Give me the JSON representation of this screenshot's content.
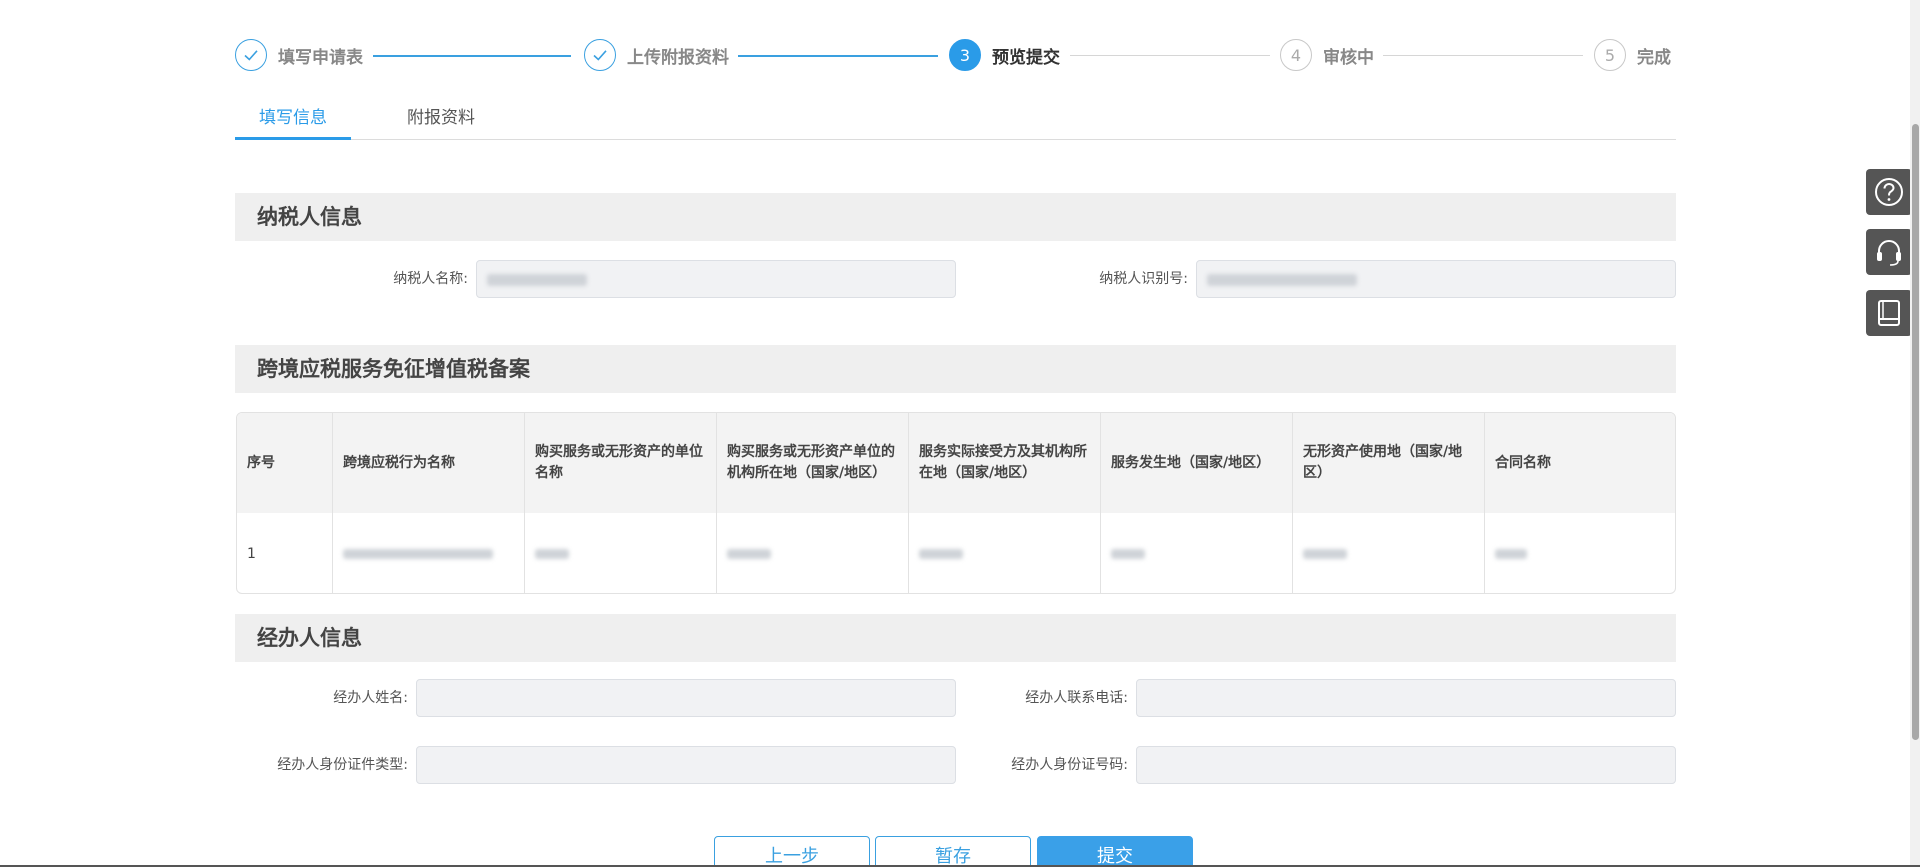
{
  "steps": [
    {
      "index": "1",
      "label": "填写申请表",
      "state": "done"
    },
    {
      "index": "2",
      "label": "上传附报资料",
      "state": "done"
    },
    {
      "index": "3",
      "label": "预览提交",
      "state": "active"
    },
    {
      "index": "4",
      "label": "审核中",
      "state": "todo"
    },
    {
      "index": "5",
      "label": "完成",
      "state": "todo"
    }
  ],
  "tabs": [
    {
      "label": "填写信息",
      "active": true
    },
    {
      "label": "附报资料",
      "active": false
    }
  ],
  "taxpayer": {
    "title": "纳税人信息",
    "name_label": "纳税人名称:",
    "id_label": "纳税人识别号:"
  },
  "filing": {
    "title": "跨境应税服务免征增值税备案",
    "columns": [
      "序号",
      "跨境应税行为名称",
      "购买服务或无形资产的单位名称",
      "购买服务或无形资产单位的机构所在地（国家/地区）",
      "服务实际接受方及其机构所在地（国家/地区）",
      "服务发生地（国家/地区）",
      "无形资产使用地（国家/地区）",
      "合同名称"
    ],
    "rows": [
      {
        "index": "1"
      }
    ]
  },
  "agent": {
    "title": "经办人信息",
    "name_label": "经办人姓名:",
    "phone_label": "经办人联系电话:",
    "id_type_label": "经办人身份证件类型:",
    "id_number_label": "经办人身份证号码:"
  },
  "buttons": {
    "prev": "上一步",
    "save": "暂存",
    "submit": "提交"
  },
  "tools": {
    "icons": [
      "help-icon",
      "headset-icon",
      "book-icon"
    ]
  },
  "colors": {
    "accent": "#2a9be8",
    "section_bg": "#efefef",
    "input_bg": "#f1f2f4",
    "tool_bg": "#555555"
  }
}
